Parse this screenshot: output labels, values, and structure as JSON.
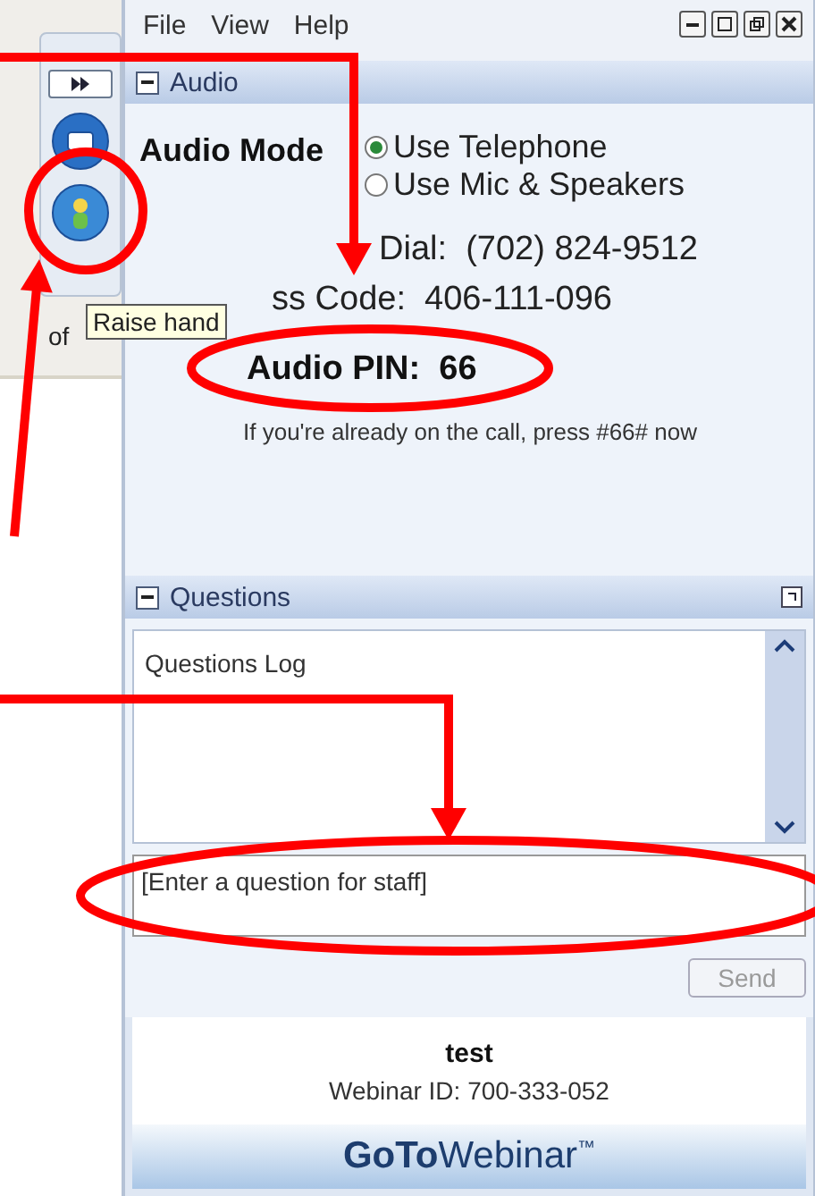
{
  "menu": [
    "File",
    "View",
    "Help"
  ],
  "audio": {
    "title": "Audio",
    "mode_label": "Audio Mode",
    "options": [
      {
        "label": "Use Telephone",
        "selected": true
      },
      {
        "label": "Use Mic & Speakers",
        "selected": false
      }
    ],
    "dial": "Dial:  (702) 824-9512",
    "access_code": "ss Code:  406-111-096",
    "pin": "Audio PIN:  66",
    "note": "If you're already on the call, press #66# now"
  },
  "tooltip": "Raise hand",
  "side_text": "of",
  "questions": {
    "title": "Questions",
    "log_label": "Questions Log",
    "placeholder": "[Enter a question for staff]",
    "send": "Send",
    "send_disabled": true
  },
  "webinar": {
    "name": "test",
    "id": "Webinar ID: 700-333-052",
    "brand_bold": "GoTo",
    "brand_light": "Webinar",
    "brand_mark": "™"
  }
}
